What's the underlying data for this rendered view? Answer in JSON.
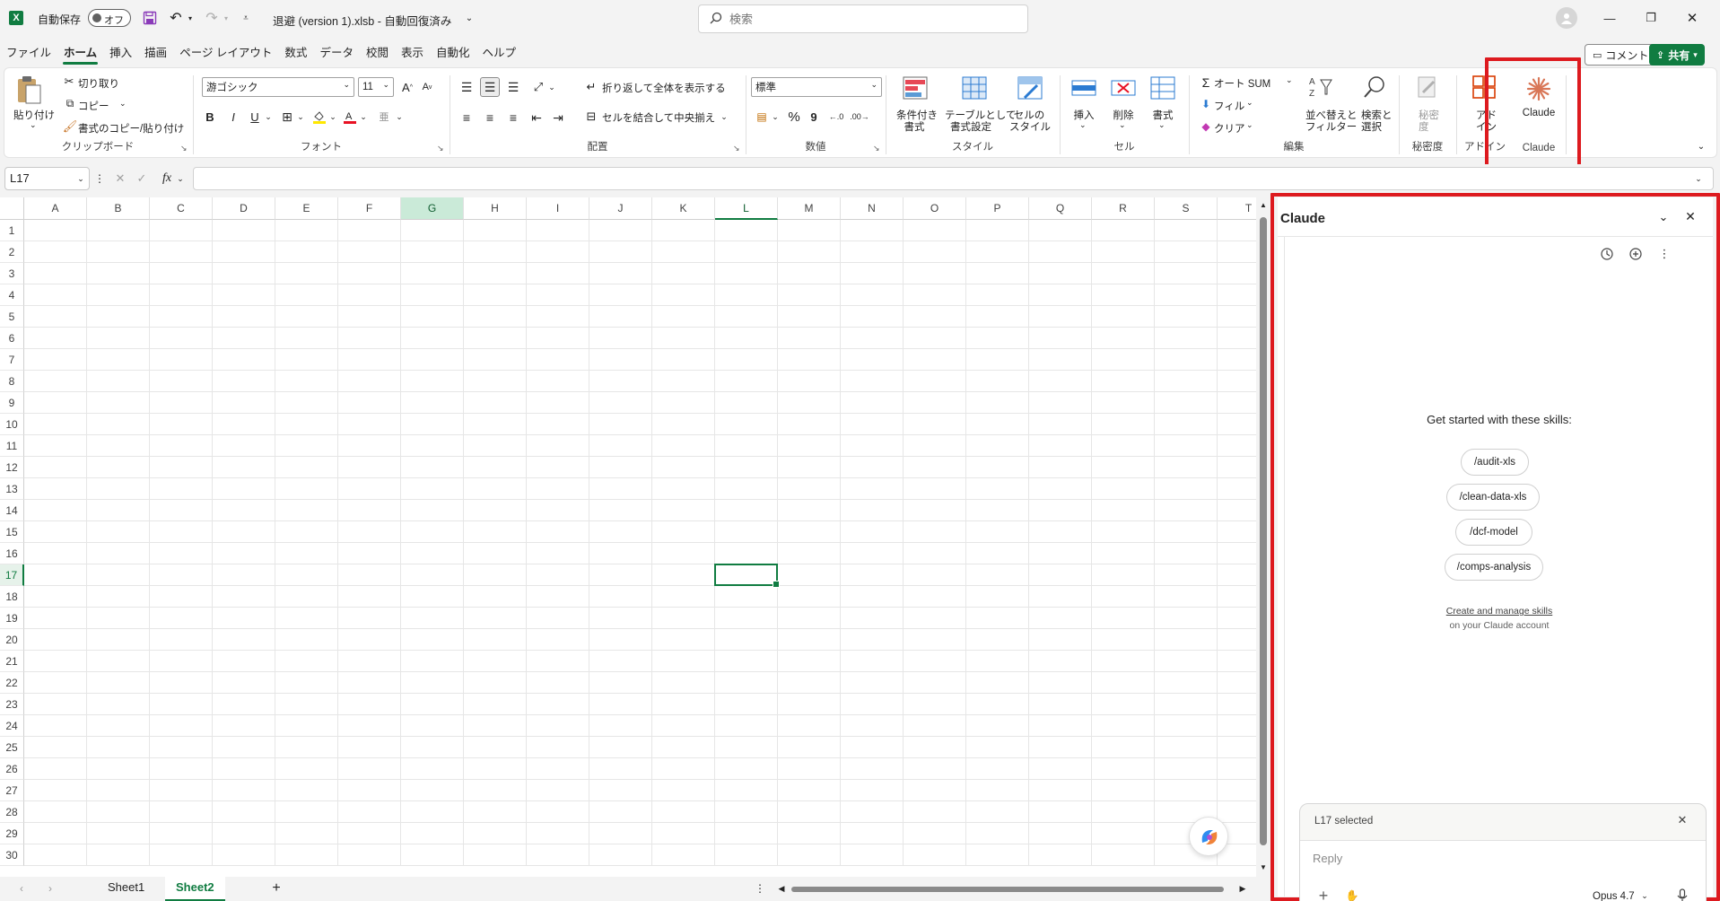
{
  "titlebar": {
    "autosave_label": "自動保存",
    "autosave_state": "オフ",
    "file_title": "退避 (version 1).xlsb  -  自動回復済み",
    "search_placeholder": "検索"
  },
  "menu_tabs": [
    "ファイル",
    "ホーム",
    "挿入",
    "描画",
    "ページ レイアウト",
    "数式",
    "データ",
    "校閲",
    "表示",
    "自動化",
    "ヘルプ"
  ],
  "active_tab": "ホーム",
  "top_buttons": {
    "comment": "コメント",
    "share": "共有"
  },
  "ribbon": {
    "clipboard": {
      "paste": "貼り付け",
      "cut": "切り取り",
      "copy": "コピー",
      "format_painter": "書式のコピー/貼り付け",
      "label": "クリップボード"
    },
    "font": {
      "family": "游ゴシック",
      "size": "11",
      "bold": "B",
      "italic": "I",
      "underline": "U",
      "label": "フォント"
    },
    "alignment": {
      "wrap": "折り返して全体を表示する",
      "merge": "セルを結合して中央揃え",
      "label": "配置"
    },
    "number": {
      "format": "標準",
      "percent": "%",
      "comma": "9",
      "label": "数値"
    },
    "styles": {
      "conditional": [
        "条件付き",
        "書式"
      ],
      "table": [
        "テーブルとして",
        "書式設定"
      ],
      "cell_styles": [
        "セルの",
        "スタイル"
      ],
      "label": "スタイル"
    },
    "cells": {
      "insert": "挿入",
      "delete": "削除",
      "format": "書式",
      "label": "セル"
    },
    "editing": {
      "autosum": "オート SUM",
      "fill": "フィル",
      "clear": "クリア",
      "sort": [
        "並べ替えと",
        "フィルター"
      ],
      "find": [
        "検索と",
        "選択"
      ],
      "label": "編集"
    },
    "sensitivity": {
      "button": [
        "秘密",
        "度"
      ],
      "label": "秘密度"
    },
    "addins": {
      "button": [
        "アド",
        "イン"
      ],
      "label": "アドイン"
    },
    "claude": {
      "button": "Claude",
      "label": "Claude"
    }
  },
  "formula_bar": {
    "name_box": "L17",
    "fx": "fx",
    "formula": ""
  },
  "grid": {
    "columns": [
      "A",
      "B",
      "C",
      "D",
      "E",
      "F",
      "G",
      "H",
      "I",
      "J",
      "K",
      "L",
      "M",
      "N",
      "O",
      "P",
      "Q",
      "R",
      "S",
      "T"
    ],
    "rows": [
      "1",
      "2",
      "3",
      "4",
      "5",
      "6",
      "7",
      "8",
      "9",
      "10",
      "11",
      "12",
      "13",
      "14",
      "15",
      "16",
      "17",
      "18",
      "19",
      "20",
      "21",
      "22",
      "23",
      "24",
      "25",
      "26",
      "27",
      "28",
      "29",
      "30"
    ],
    "highlighted_column": "G",
    "active_column": "L",
    "active_row": "17"
  },
  "sheets": [
    "Sheet1",
    "Sheet2"
  ],
  "claude_panel": {
    "title": "Claude",
    "intro": "Get started with these skills:",
    "skills": [
      "/audit-xls",
      "/clean-data-xls",
      "/dcf-model",
      "/comps-analysis"
    ],
    "manage_link": "Create and manage skills",
    "manage_sub": "on your Claude account",
    "selection": "L17 selected",
    "reply_placeholder": "Reply",
    "model": "Opus 4.7"
  },
  "colors": {
    "excel_green": "#107c41",
    "claude_orange": "#d97757",
    "highlight_red": "#dd1a1f"
  }
}
